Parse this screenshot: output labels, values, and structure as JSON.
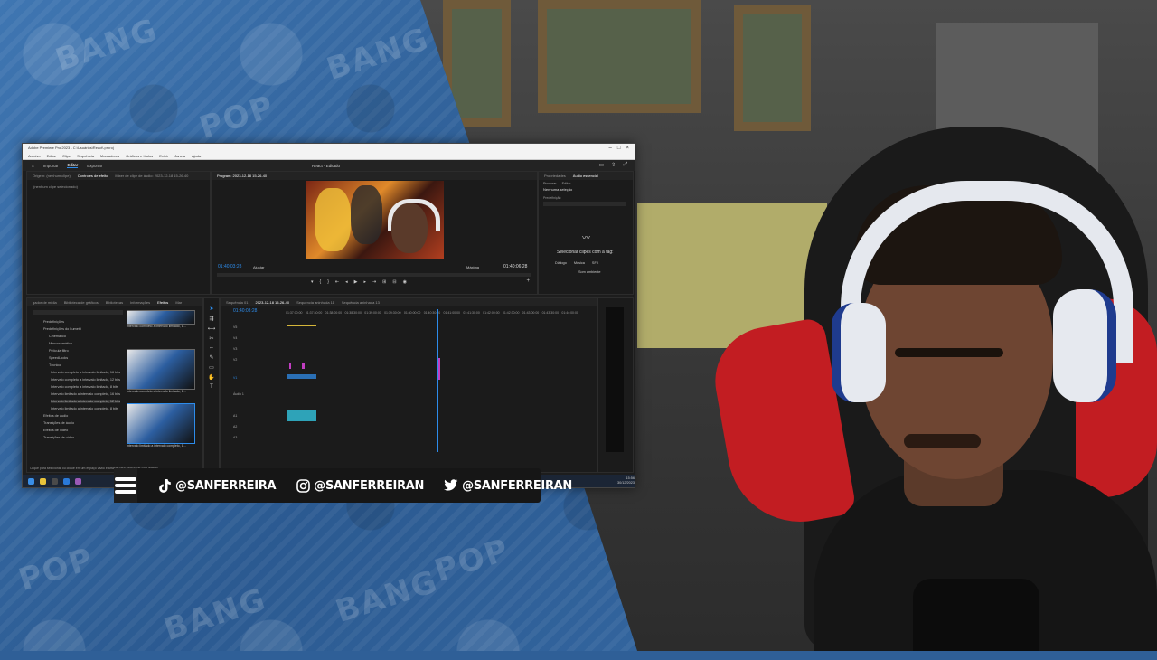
{
  "premiere": {
    "window_title": "Adobe Premiere Pro 2023 - C:\\Usuários\\React\\.prproj",
    "menu": [
      "Arquivo",
      "Editar",
      "Clipe",
      "Sequência",
      "Marcadores",
      "Gráficos e títulos",
      "Exibir",
      "Janela",
      "Ajuda"
    ],
    "workspace_tabs": [
      "Importar",
      "Editar",
      "Exportar"
    ],
    "active_workspace": "Editar",
    "project_name": "React - Editado",
    "source_tabs": [
      "Origem: (nenhum clipe)",
      "Controles de efeito",
      "Mixer de clipe de áudio: 2023-12-18 15-26-40",
      "Program: 2023-12-18 15-26-40"
    ],
    "no_clip_text": "(nenhum clipe selecionado)",
    "program": {
      "timecode_left": "01:40:03:28",
      "fit": "Ajustar",
      "quality": "Máxima",
      "timecode_right": "01:40:06:28"
    },
    "essential_sound": {
      "tabs": [
        "Propriedades",
        "Áudio essencial"
      ],
      "subtabs": [
        "Procurar",
        "Editar"
      ],
      "no_selection": "Nenhuma seleção",
      "preset_label": "Predefinição",
      "select_prompt": "Selecionar clipes com a tag:",
      "tag_buttons": [
        "Diálogo",
        "Música",
        "SFX"
      ],
      "ambience": "Som ambiente"
    },
    "effects_tabs": [
      "gador de mídia",
      "Biblioteca de gráficos",
      "Bibliotecas",
      "Informações",
      "Efeitos",
      "Mar"
    ],
    "effects_tree": [
      "Predefinições",
      "Predefinições do Lumetri",
      "Cinemático",
      "Monocromático",
      "Película filtro",
      "SpeedLooks",
      "Técnico",
      "Intervalo completo a intervalo limitado, 16 bits",
      "Intervalo completo a intervalo limitado, 12 bits",
      "Intervalo completo a intervalo limitado, 8 bits",
      "Intervalo limitado a intervalo completo, 16 bits",
      "Intervalo limitado a intervalo completo, 12 bits",
      "Intervalo limitado a intervalo completo, 8 bits",
      "Efeitos de áudio",
      "Transições de áudio",
      "Efeitos de vídeo",
      "Transições de vídeo"
    ],
    "thumb_labels": [
      "Intervalo completo a intervalo limitado, 1…",
      "Intervalo completo a intervalo limitado, 1…",
      "Intervalo limitado a intervalo completo, 1…"
    ],
    "timeline_tabs": [
      "Sequência 01",
      "2023-12-18 15-26-40",
      "Sequência aninhada 11",
      "Sequência aninhada 13"
    ],
    "timeline_timecode": "01:40:03:28",
    "ruler": [
      "01:37:00:00",
      "01:37:30:00",
      "01:38:00:00",
      "01:38:30:00",
      "01:39:00:00",
      "01:39:30:00",
      "01:40:00:00",
      "01:40:30:00",
      "01:41:00:00",
      "01:41:30:00",
      "01:42:00:00",
      "01:42:30:00",
      "01:43:00:00",
      "01:43:30:00",
      "01:44:00:00"
    ],
    "tracks": [
      "V5",
      "V4",
      "V3",
      "V2",
      "V1",
      "A1",
      "A2",
      "A3"
    ],
    "audio_label": "Áudio 1",
    "status_text": "Clique para selecionar ou clique em um espaço vazio e arraste para selecionar com letreiro...",
    "tray_time": "15:56",
    "tray_date": "30/12/2023"
  },
  "social": {
    "tiktok": "@SANFERREIRA",
    "instagram": "@SANFERREIRAN",
    "twitter": "@SANFERREIRAN"
  },
  "background_words": [
    "BANG",
    "POP",
    "BANG",
    "POP",
    "BANG",
    "POP",
    "BANG"
  ]
}
